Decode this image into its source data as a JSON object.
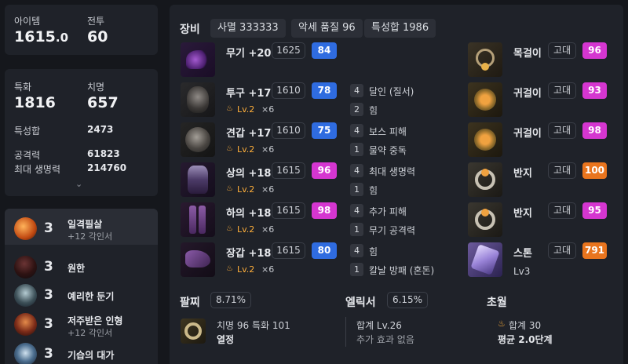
{
  "summary": {
    "item_label": "아이템",
    "item_value_main": "1615",
    "item_value_frac": ".0",
    "battle_label": "전투",
    "battle_value": "60"
  },
  "stats": {
    "crit_spec_label": "특화",
    "crit_spec_value": "1816",
    "crit_label": "치명",
    "crit_value": "657",
    "total_label": "특성합",
    "total_value": "2473",
    "atk_label": "공격력",
    "atk_value": "61823",
    "hp_label": "최대 생명력",
    "hp_value": "214760"
  },
  "engravings": [
    {
      "level": "3",
      "name": "일격필살",
      "sub": "+12 각인서"
    },
    {
      "level": "3",
      "name": "원한",
      "sub": ""
    },
    {
      "level": "3",
      "name": "예리한 둔기",
      "sub": ""
    },
    {
      "level": "3",
      "name": "저주받은 인형",
      "sub": "+12 각인서"
    },
    {
      "level": "3",
      "name": "기습의 대가",
      "sub": ""
    }
  ],
  "equipment": {
    "header": "장비",
    "tags": [
      "사멸 333333",
      "악세 품질 96",
      "특성합 1986"
    ],
    "gear": [
      {
        "name": "무기 +20",
        "ilvl": "1625",
        "quality": "84",
        "gem": "",
        "gem_count": ""
      },
      {
        "name": "투구 +17",
        "ilvl": "1610",
        "quality": "78",
        "gem": "Lv.2",
        "gem_count": "×6"
      },
      {
        "name": "견갑 +17",
        "ilvl": "1610",
        "quality": "75",
        "gem": "Lv.2",
        "gem_count": "×6"
      },
      {
        "name": "상의 +18",
        "ilvl": "1615",
        "quality": "96",
        "gem": "Lv.2",
        "gem_count": "×6"
      },
      {
        "name": "하의 +18",
        "ilvl": "1615",
        "quality": "98",
        "gem": "Lv.2",
        "gem_count": "×6"
      },
      {
        "name": "장갑 +18",
        "ilvl": "1615",
        "quality": "80",
        "gem": "Lv.2",
        "gem_count": "×6"
      }
    ],
    "set_effects": [
      {
        "n": "4",
        "t": "달인 (질서)"
      },
      {
        "n": "2",
        "t": "힘"
      },
      {
        "n": "4",
        "t": "보스 피해"
      },
      {
        "n": "1",
        "t": "물약 중독"
      },
      {
        "n": "4",
        "t": "최대 생명력"
      },
      {
        "n": "1",
        "t": "힘"
      },
      {
        "n": "4",
        "t": "추가 피해"
      },
      {
        "n": "1",
        "t": "무기 공격력"
      },
      {
        "n": "4",
        "t": "힘"
      },
      {
        "n": "1",
        "t": "칼날 방패 (혼돈)"
      }
    ],
    "accessories": [
      {
        "name": "목걸이",
        "grade": "고대",
        "quality": "96"
      },
      {
        "name": "귀걸이",
        "grade": "고대",
        "quality": "93"
      },
      {
        "name": "귀걸이",
        "grade": "고대",
        "quality": "98"
      },
      {
        "name": "반지",
        "grade": "고대",
        "quality": "100"
      },
      {
        "name": "반지",
        "grade": "고대",
        "quality": "95"
      },
      {
        "name": "스톤",
        "grade": "고대",
        "quality": "791",
        "sub": "Lv3"
      }
    ]
  },
  "bracelet": {
    "label": "팔찌",
    "pct": "8.71%",
    "stats": "치명 96   특화 101",
    "effect": "열정"
  },
  "elixir": {
    "label": "엘릭서",
    "pct": "6.15%",
    "total": "합계 Lv.26",
    "effect": "추가 효과 없음"
  },
  "transcend": {
    "label": "초월",
    "total": "합계 30",
    "avg": "평균 2.0단계"
  },
  "colors": {
    "blue": "#2f6ce0",
    "magenta": "#d536d0",
    "orange": "#e9751e",
    "gold": "#ffaf3a"
  },
  "icons": {
    "gem": "flame-gem-icon",
    "expand": "chevron-down-icon"
  }
}
